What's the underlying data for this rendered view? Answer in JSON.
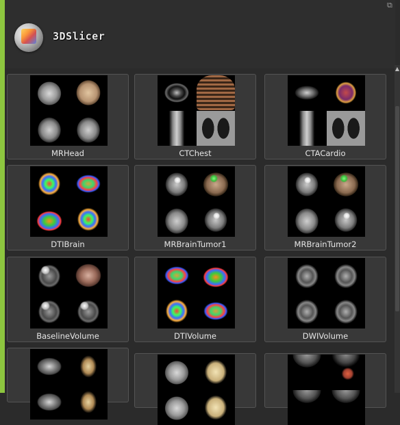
{
  "app": {
    "brand": "3DSlicer"
  },
  "window": {
    "undock_glyph": "⧉"
  },
  "scrollbar": {
    "up_glyph": "▲"
  },
  "samples": [
    {
      "label": "MRHead"
    },
    {
      "label": "CTChest"
    },
    {
      "label": "CTACardio"
    },
    {
      "label": "DTIBrain"
    },
    {
      "label": "MRBrainTumor1"
    },
    {
      "label": "MRBrainTumor2"
    },
    {
      "label": "BaselineVolume"
    },
    {
      "label": "DTIVolume"
    },
    {
      "label": "DWIVolume"
    },
    {
      "label": ""
    },
    {
      "label": ""
    },
    {
      "label": ""
    }
  ],
  "colors": {
    "accent": "#8dc63f",
    "background": "#2b2b2b",
    "tile": "#383838"
  }
}
